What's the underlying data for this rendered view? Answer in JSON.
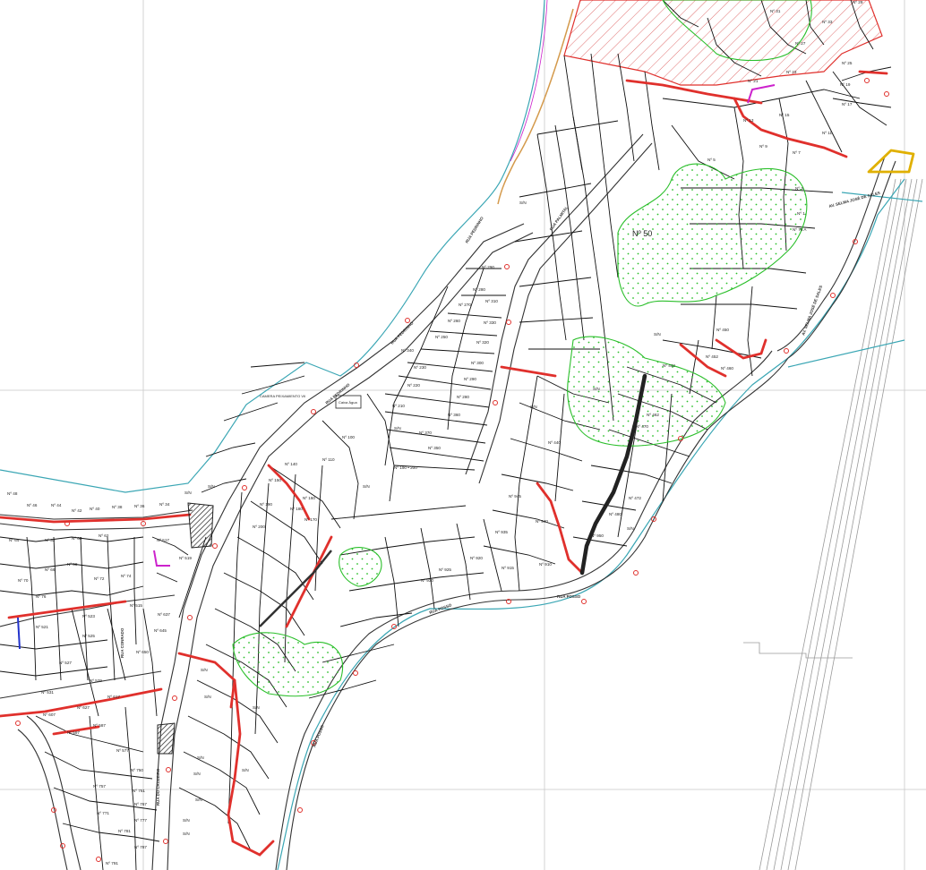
{
  "map": {
    "colors": {
      "background": "#ffffff",
      "parcel_line": "#111111",
      "road_edge": "#333333",
      "red_highlight": "#e0302c",
      "green_zone": "#2bbf2b",
      "cyan_boundary": "#3aa6b4",
      "orange_boundary": "#d49a4c",
      "magenta": "#cc22cc",
      "yellow_feature": "#e0b000",
      "grid": "#c8c8c8",
      "hatch_red": "#e07070"
    },
    "streets": [
      {
        "text": "RUA PEDRINHO"
      },
      {
        "text": "RUA PEDRINHO"
      },
      {
        "text": "RUA PEDRINHO"
      },
      {
        "text": "RUA POSSO"
      },
      {
        "text": "RUA POSSO"
      },
      {
        "text": "RUA POSSO"
      },
      {
        "text": "RUA CONRADO"
      },
      {
        "text": "RUA DO CRUZEIRO"
      },
      {
        "text": "AV. SELMA JOSÉ DE SALES"
      },
      {
        "text": "AV. SELMA JOSÉ DE SALES"
      },
      {
        "text": "RUA PALMITAL"
      }
    ],
    "big_labels": [
      {
        "text": "Nº 50"
      }
    ],
    "box_labels": [
      {
        "text": "CAMERA PEIXAMIENTO VII"
      },
      {
        "text": "Caixa Água"
      }
    ],
    "lots": [
      "Nº 290",
      "Nº 280",
      "Nº 270",
      "Nº 260",
      "Nº 250",
      "Nº 340",
      "Nº 330",
      "Nº 320",
      "Nº 310",
      "Nº 300",
      "Nº 290",
      "Nº 280",
      "Nº 230",
      "Nº 220",
      "Nº 210",
      "Nº 370",
      "Nº 360",
      "Nº 350",
      "Nº 100",
      "Nº 110",
      "Nº 140",
      "Nº 150",
      "Nº 160",
      "Nº 170",
      "Nº 180",
      "Nº 190",
      "Nº 200",
      "Nº 190 • 200",
      "S/N",
      "S/N",
      "S/N",
      "S/N",
      "S/N",
      "S/N",
      "S/N",
      "S/N",
      "Nº 33",
      "Nº 31",
      "Nº 29",
      "Nº 27",
      "Nº 25",
      "Nº 23",
      "Nº 21",
      "Nº 19",
      "Nº 17",
      "Nº 15",
      "Nº 13",
      "Nº 11",
      "Nº 9",
      "Nº 7",
      "Nº 5",
      "Nº 3",
      "Nº 1",
      "Nº 75 A",
      "Nº 48",
      "Nº 46",
      "Nº 44",
      "Nº 42",
      "Nº 40",
      "Nº 38",
      "Nº 36",
      "Nº 34",
      "Nº 32",
      "Nº 60",
      "Nº 62",
      "Nº 64",
      "Nº 66",
      "Nº 68",
      "Nº 70",
      "Nº 72",
      "Nº 74",
      "Nº 76",
      "Nº 515",
      "Nº 517",
      "Nº 519",
      "Nº 521",
      "Nº 523",
      "Nº 525",
      "Nº 527",
      "Nº 529",
      "Nº 531",
      "Nº 650",
      "Nº 645",
      "Nº 637",
      "Nº 627",
      "Nº 617",
      "Nº 607",
      "Nº 597",
      "Nº 587",
      "Nº 577",
      "Nº 750",
      "Nº 757",
      "Nº 761",
      "Nº 767",
      "Nº 771",
      "Nº 777",
      "Nº 781",
      "Nº 787",
      "Nº 791",
      "Nº 910",
      "Nº 915",
      "Nº 920",
      "Nº 925",
      "Nº 930",
      "Nº 935",
      "Nº 940",
      "Nº 945",
      "Nº 950",
      "Nº 440",
      "Nº 442",
      "Nº 450",
      "Nº 452",
      "Nº 460",
      "Nº 462",
      "Nº 470",
      "Nº 472",
      "Nº 480",
      "S/N",
      "S/N",
      "S/N",
      "S/N",
      "S/N",
      "S/N",
      "S/N",
      "S/N",
      "S/N",
      "S/N"
    ]
  }
}
